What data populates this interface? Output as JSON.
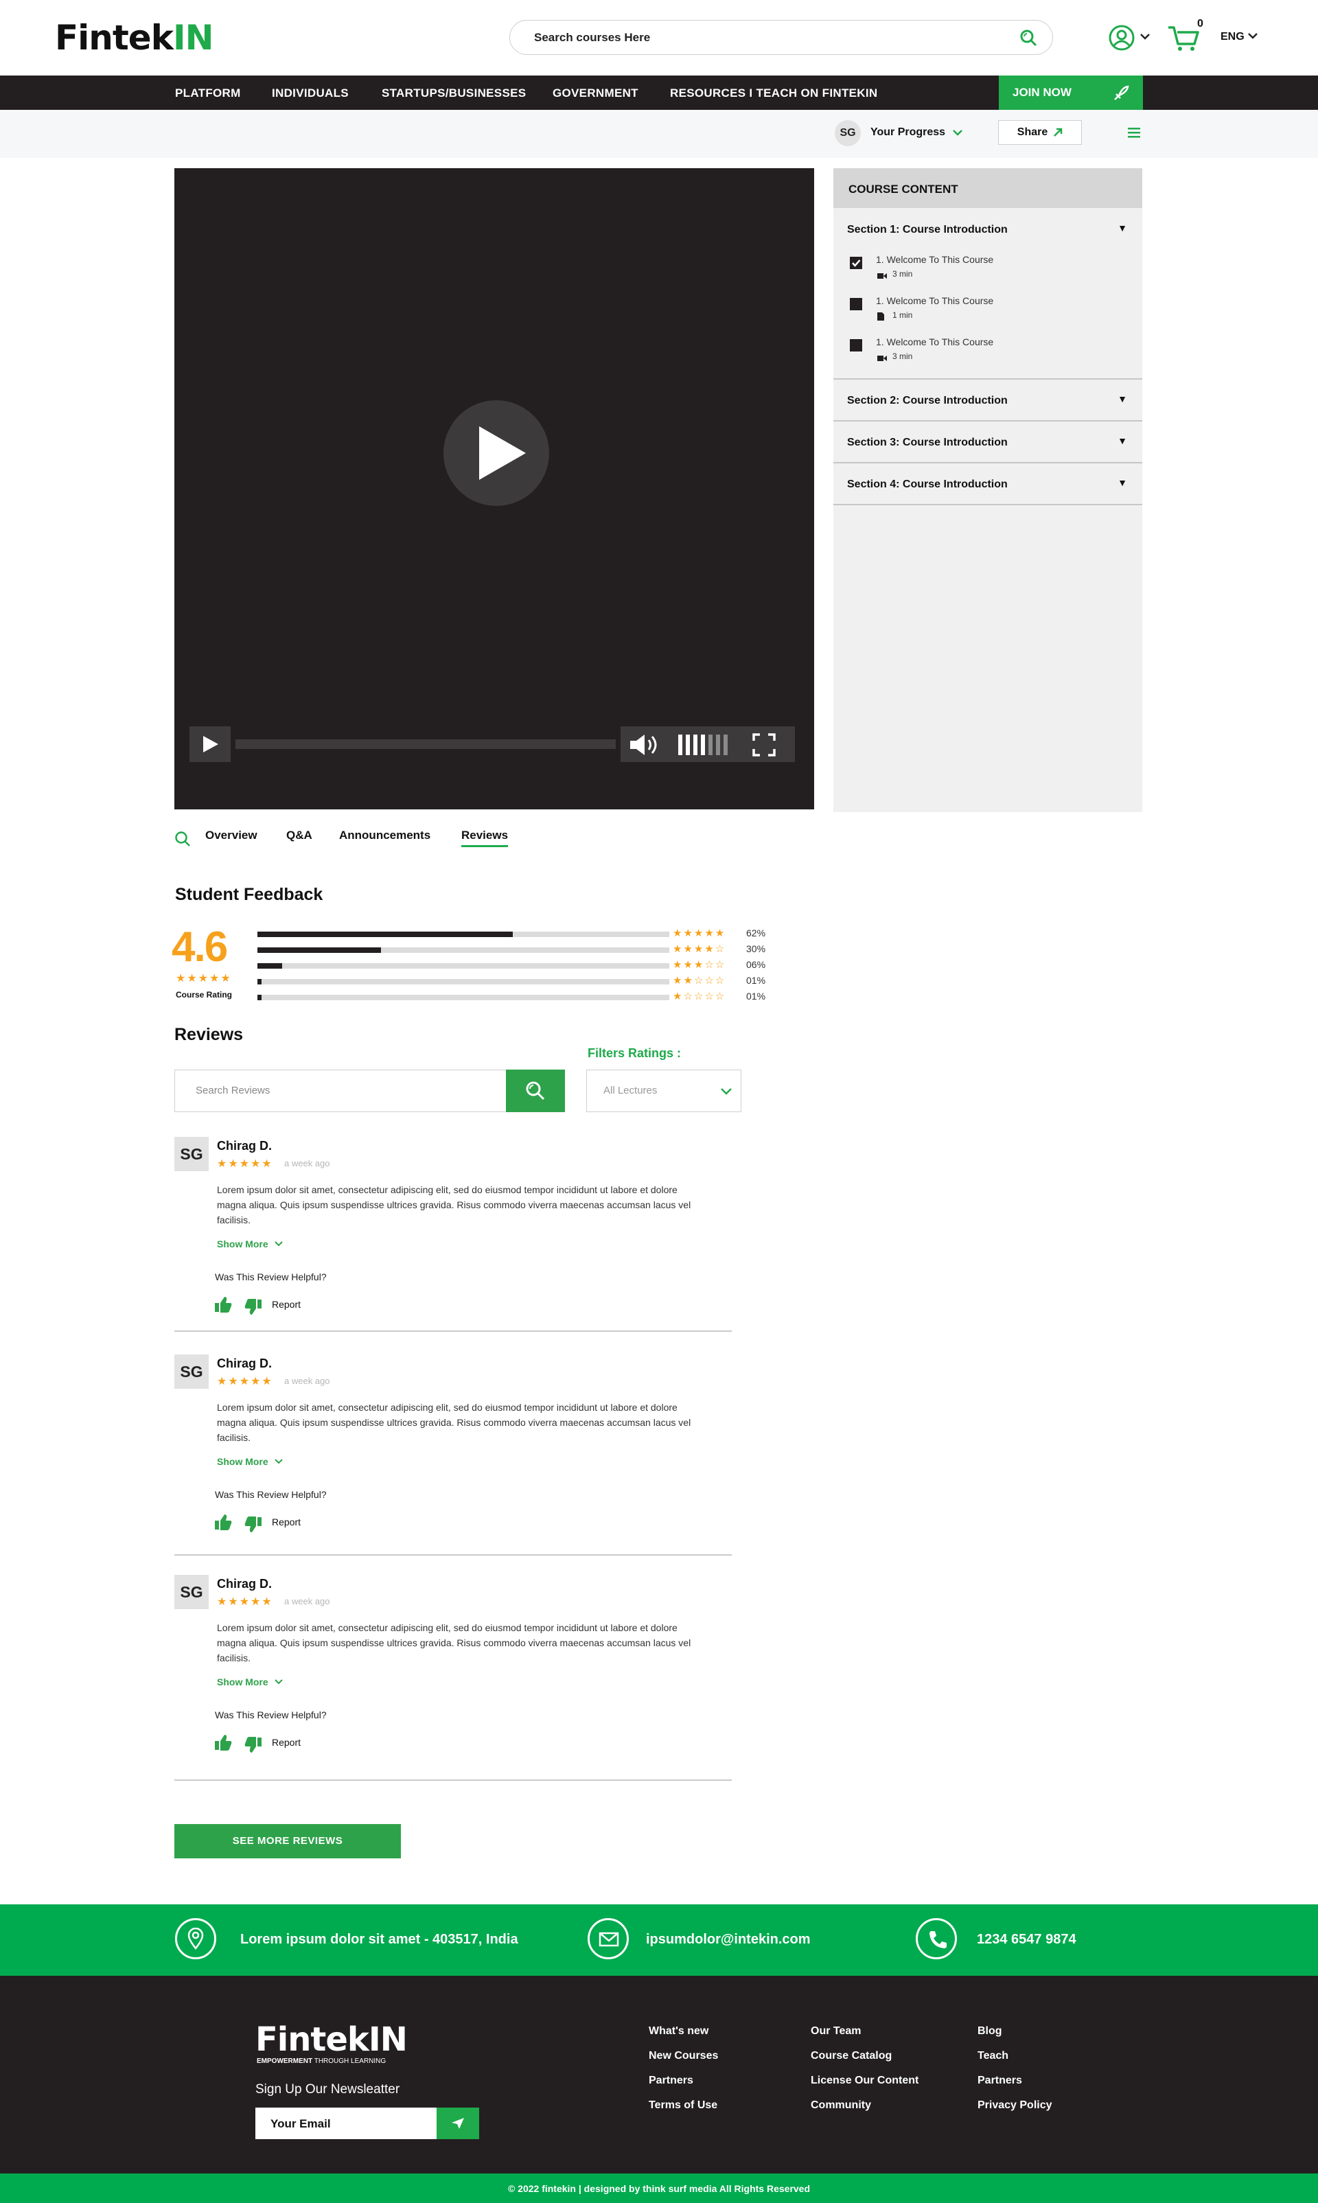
{
  "header": {
    "logo_main": "Fintek",
    "logo_accent": "IN",
    "search_placeholder": "Search courses Here",
    "cart_count": "0",
    "language": "ENG"
  },
  "nav": {
    "items": [
      "PLATFORM",
      "INDIVIDUALS",
      "STARTUPS/BUSINESSES",
      "GOVERNMENT",
      "RESOURCES I TEACH ON FINTEKIN"
    ],
    "join": "JOIN NOW"
  },
  "subbar": {
    "initials": "SG",
    "progress": "Your Progress",
    "share": "Share"
  },
  "player": {
    "volume_level": 0.7
  },
  "course_content": {
    "title": "COURSE CONTENT",
    "sections": [
      {
        "title": "Section 1: Course Introduction"
      },
      {
        "title": "Section 2: Course Introduction"
      },
      {
        "title": "Section 3: Course Introduction"
      },
      {
        "title": "Section 4: Course Introduction"
      }
    ],
    "lectures": [
      {
        "title": "1. Welcome To This Course",
        "duration": "3 min",
        "icon": "video-icon",
        "checked": true
      },
      {
        "title": "1. Welcome To This Course",
        "duration": "1 min",
        "icon": "document-icon",
        "checked": false
      },
      {
        "title": "1. Welcome To This Course",
        "duration": "3 min",
        "icon": "video-icon",
        "checked": false
      }
    ]
  },
  "tabs": [
    "Overview",
    "Q&A",
    "Announcements",
    "Reviews"
  ],
  "feedback": {
    "title": "Student Feedback",
    "rating": "4.6",
    "rating_label": "Course Rating",
    "distribution": [
      {
        "stars": 5,
        "percent": 62,
        "label": "62%"
      },
      {
        "stars": 4,
        "percent": 30,
        "label": "30%"
      },
      {
        "stars": 3,
        "percent": 6,
        "label": "06%"
      },
      {
        "stars": 2,
        "percent": 1,
        "label": "01%"
      },
      {
        "stars": 1,
        "percent": 1,
        "label": "01%"
      }
    ]
  },
  "reviews": {
    "title": "Reviews",
    "filter_label": "Filters Ratings :",
    "search_placeholder": "Search Reviews",
    "filter_value": "All Lectures",
    "items": [
      {
        "initials": "SG",
        "name": "Chirag D.",
        "ago": "a week ago",
        "body": "Lorem ipsum dolor sit amet, consectetur adipiscing elit, sed do eiusmod tempor incididunt ut labore et dolore magna aliqua. Quis ipsum suspendisse ultrices gravida. Risus commodo viverra maecenas accumsan lacus vel facilisis.",
        "more": "Show More",
        "helpful": "Was This Review Helpful?",
        "report": "Report"
      },
      {
        "initials": "SG",
        "name": "Chirag D.",
        "ago": "a week ago",
        "body": "Lorem ipsum dolor sit amet, consectetur adipiscing elit, sed do eiusmod tempor incididunt ut labore et dolore magna aliqua. Quis ipsum suspendisse ultrices gravida. Risus commodo viverra maecenas accumsan lacus vel facilisis.",
        "more": "Show More",
        "helpful": "Was This Review Helpful?",
        "report": "Report"
      },
      {
        "initials": "SG",
        "name": "Chirag D.",
        "ago": "a week ago",
        "body": "Lorem ipsum dolor sit amet, consectetur adipiscing elit, sed do eiusmod tempor incididunt ut labore et dolore magna aliqua. Quis ipsum suspendisse ultrices gravida. Risus commodo viverra maecenas accumsan lacus vel facilisis.",
        "more": "Show More",
        "helpful": "Was This Review Helpful?",
        "report": "Report"
      }
    ],
    "see_more": "SEE MORE REVIEWS"
  },
  "contact": {
    "address": "Lorem ipsum dolor sit amet - 403517, India",
    "email": "ipsumdolor@intekin.com",
    "phone": "1234 6547 9874"
  },
  "footer": {
    "logo_main": "FintekIN",
    "tagline_a": "EMPOWERMENT",
    "tagline_b": " THROUGH LEARNING",
    "newsletter": "Sign Up Our Newsleatter",
    "email_placeholder": "Your Email",
    "col1": [
      "What's new",
      "New Courses",
      "Partners",
      "Terms of Use"
    ],
    "col2": [
      "Our Team",
      "Course Catalog",
      "License Our Content",
      "Community"
    ],
    "col3": [
      "Blog",
      "Teach",
      "Partners",
      "Privacy Policy"
    ],
    "copyright": "© 2022 fintekin | designed by think surf media All Rights Reserved"
  },
  "colors": {
    "brand_green": "#1faa4b",
    "dark": "#231f20",
    "star": "#f6a11c",
    "rating": "#f6a11c"
  }
}
